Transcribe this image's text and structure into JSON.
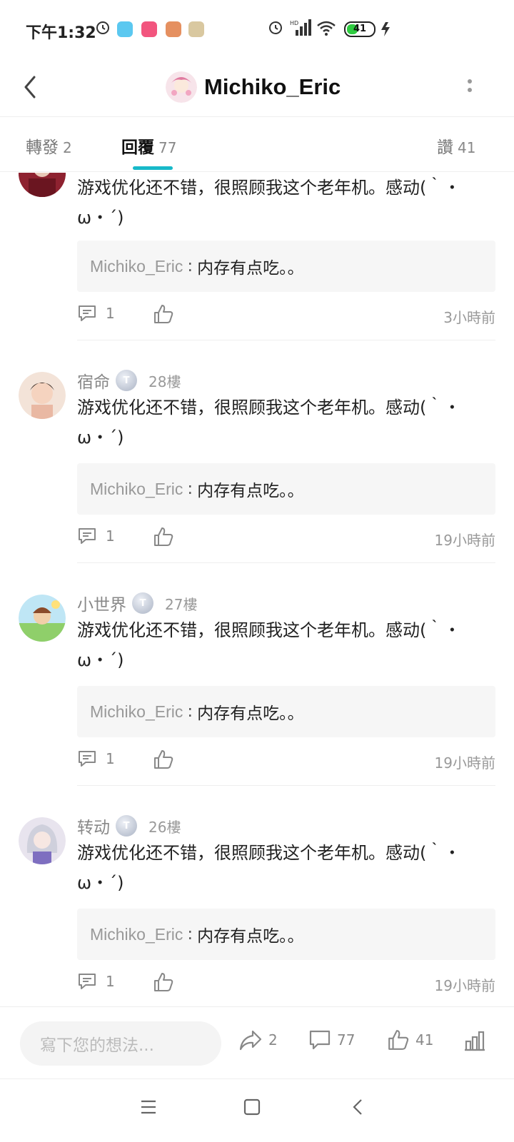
{
  "status": {
    "time": "下午1:32",
    "battery": "41",
    "battery_level": 0.41
  },
  "header": {
    "title": "Michiko_Eric"
  },
  "tabs": [
    {
      "label": "轉發",
      "count": "2"
    },
    {
      "label": "回覆",
      "count": "77"
    },
    {
      "label": "讚",
      "count": "41"
    }
  ],
  "replies": [
    {
      "user": "",
      "floor": "",
      "content": "游戏优化还不错，很照顾我这个老年机。感动(｀・ω・´)",
      "quote_user": "Michiko_Eric",
      "quote_sep": ":",
      "quote_text": "内存有点吃。。",
      "comment_count": "1",
      "time": "3小時前"
    },
    {
      "user": "宿命",
      "floor": "28樓",
      "content": "游戏优化还不错，很照顾我这个老年机。感动(｀・ω・´)",
      "quote_user": "Michiko_Eric",
      "quote_sep": ":",
      "quote_text": "内存有点吃。。",
      "comment_count": "1",
      "time": "19小時前"
    },
    {
      "user": "小世界",
      "floor": "27樓",
      "content": "游戏优化还不错，很照顾我这个老年机。感动(｀・ω・´)",
      "quote_user": "Michiko_Eric",
      "quote_sep": ":",
      "quote_text": "内存有点吃。。",
      "comment_count": "1",
      "time": "19小時前"
    },
    {
      "user": "转动",
      "floor": "26樓",
      "content": "游戏优化还不错，很照顾我这个老年机。感动(｀・ω・´)",
      "quote_user": "Michiko_Eric",
      "quote_sep": ":",
      "quote_text": "内存有点吃。。",
      "comment_count": "1",
      "time": "19小時前"
    }
  ],
  "bottom_bar": {
    "input_placeholder": "寫下您的想法...",
    "share_count": "2",
    "comment_count": "77",
    "like_count": "41"
  },
  "icons": {
    "back": "chevron-left-icon",
    "more": "more-vertical-icon",
    "comment": "comment-icon",
    "like": "thumbs-up-icon",
    "share": "share-icon",
    "stats": "bar-chart-icon"
  },
  "colors": {
    "accent": "#17b9c9",
    "quote_bg": "#f6f6f6"
  }
}
